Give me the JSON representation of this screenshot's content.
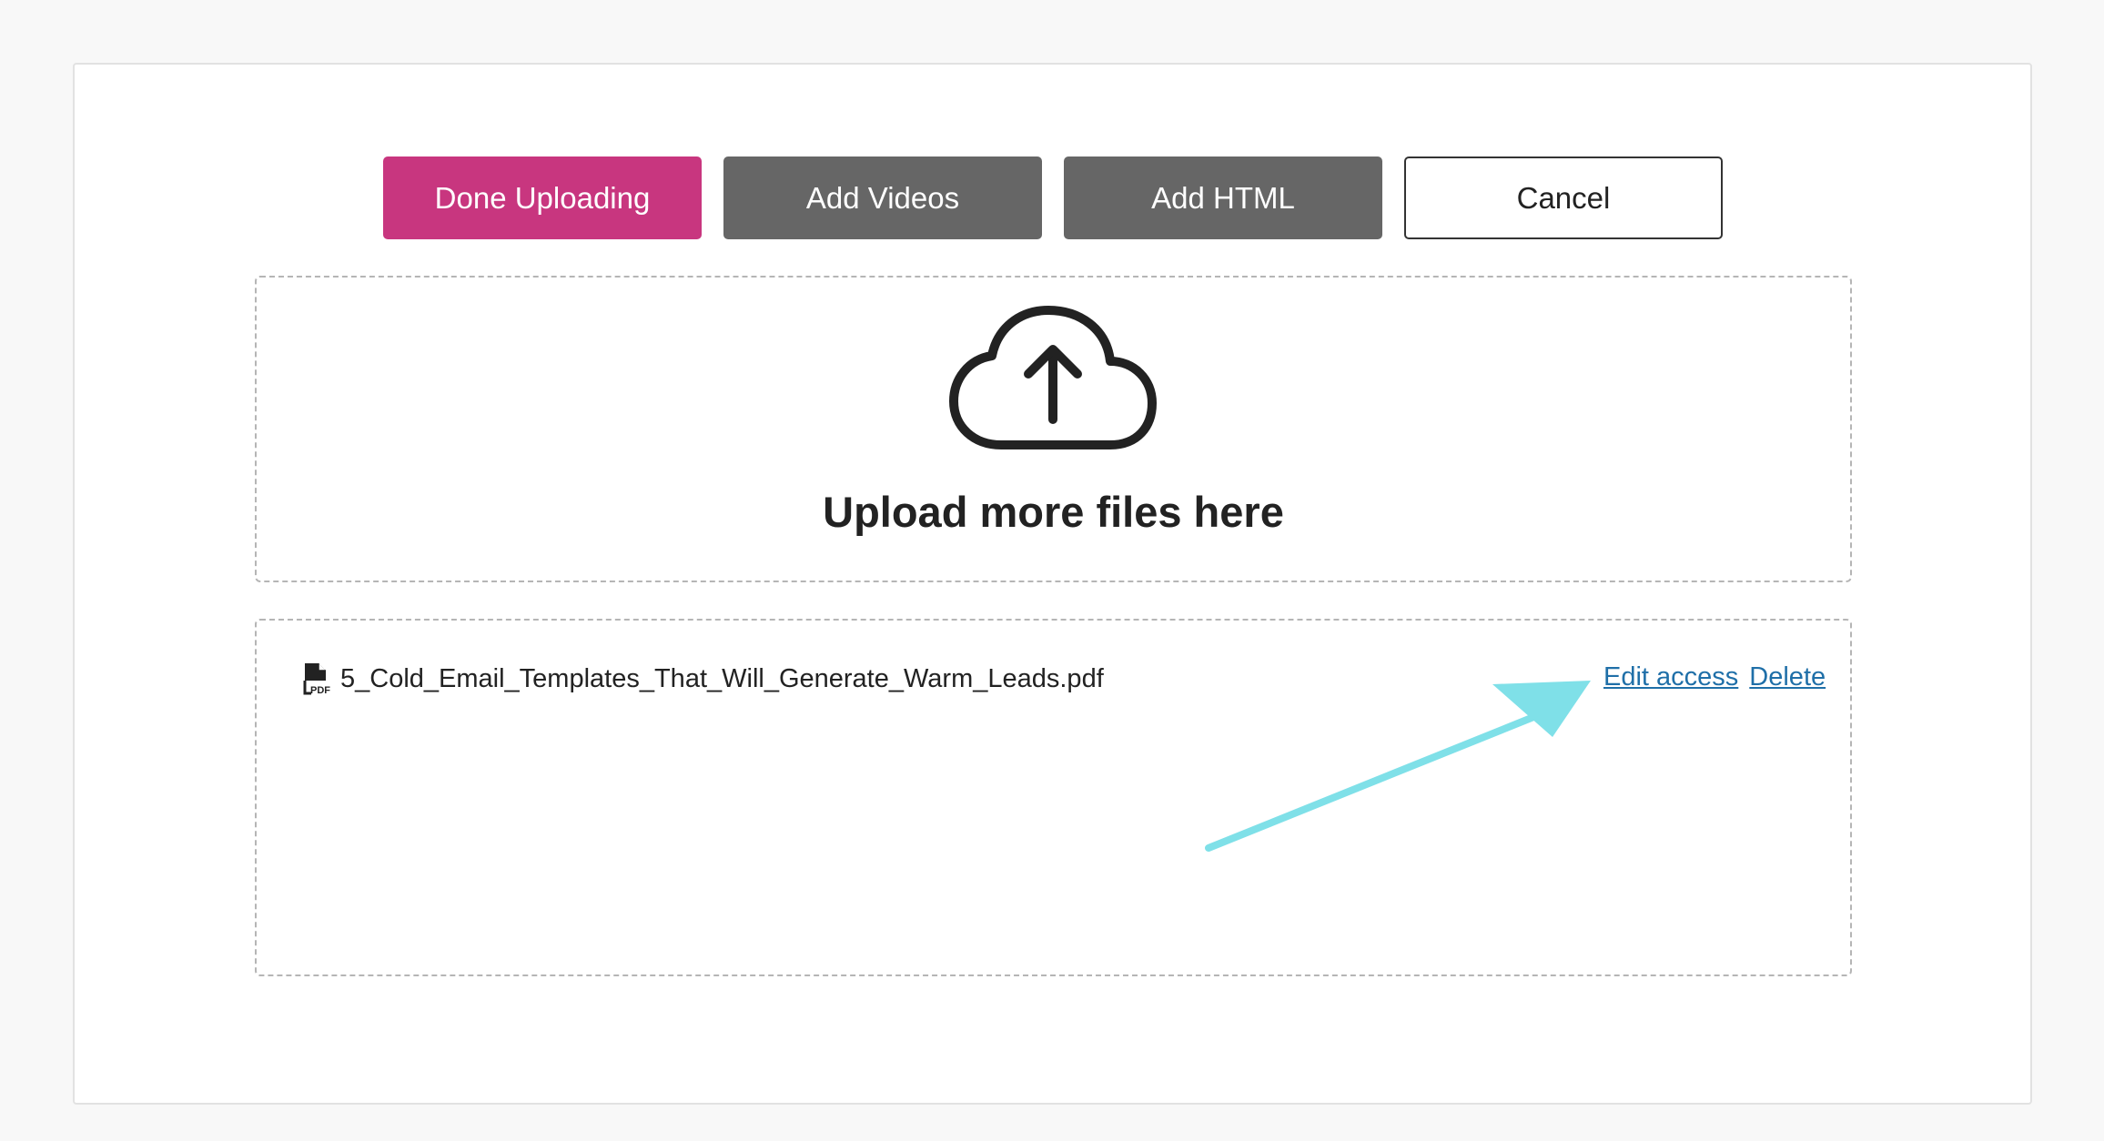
{
  "toolbar": {
    "done_label": "Done Uploading",
    "videos_label": "Add Videos",
    "html_label": "Add HTML",
    "cancel_label": "Cancel"
  },
  "dropzone": {
    "title": "Upload more files here",
    "icon": "cloud-upload-icon"
  },
  "files": [
    {
      "name": "5_Cold_Email_Templates_That_Will_Generate_Warm_Leads.pdf",
      "icon": "pdf-file-icon",
      "edit_access_label": "Edit access",
      "delete_label": "Delete"
    }
  ],
  "colors": {
    "primary": "#c8367f",
    "secondary": "#666666",
    "link": "#1f6fa8",
    "annotation_arrow": "#7fe0e8"
  }
}
